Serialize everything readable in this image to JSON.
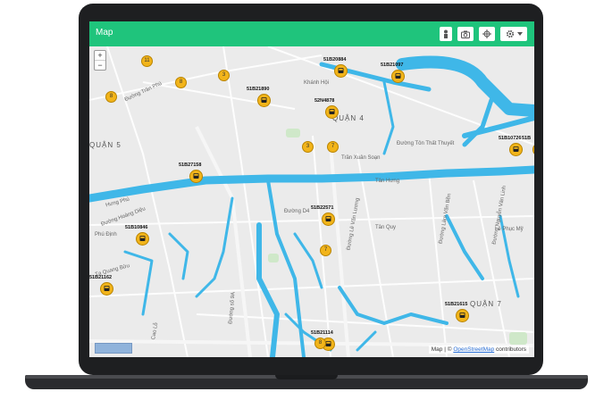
{
  "window": {
    "title": "Map"
  },
  "toolbar": {
    "buttons": [
      {
        "icon": "person-icon"
      },
      {
        "icon": "camera-icon"
      },
      {
        "icon": "crosshair-icon"
      },
      {
        "icon": "gear-icon",
        "has_dropdown": true
      }
    ]
  },
  "zoom": {
    "in_label": "+",
    "out_label": "−"
  },
  "map": {
    "districts": [
      "QUẬN 4",
      "QUẬN 7",
      "QUẬN 5"
    ],
    "streets": [
      "Đường Trần Phú",
      "Đường Tôn Thất Thuyết",
      "Trần Xuân Soạn",
      "Tân Hưng",
      "Đường Lâm Văn Bền",
      "Đường Nguyễn Văn Linh",
      "Lê Phục Mỹ",
      "Đường D4",
      "Đường Lê Văn Lương",
      "Tân Quy",
      "Đường Hoàng Diệu",
      "Tạ Quang Bửu",
      "Cao Lỗ",
      "Đường số 9A",
      "Hưng Phú",
      "Phú Định",
      "Khánh Hội"
    ],
    "vehicles": [
      {
        "label": "51B20884"
      },
      {
        "label": "51B21097"
      },
      {
        "label": "51B21890"
      },
      {
        "label": "52N4878"
      },
      {
        "label": "51B10726"
      },
      {
        "label": "51B27158"
      },
      {
        "label": "51B22571"
      },
      {
        "label": "51B10846"
      },
      {
        "label": "51B21162"
      },
      {
        "label": "51B21615"
      },
      {
        "label": "51B21114"
      },
      {
        "label": "51B"
      }
    ],
    "clusters": [
      "11",
      "8",
      "8",
      "3",
      "3",
      "7",
      "7",
      "8"
    ]
  },
  "attribution": {
    "brand": "Map",
    "separator": "|",
    "copyright": "©",
    "link": "OpenStreetMap",
    "suffix": "contributors"
  },
  "colors": {
    "titlebar": "#1fc47c",
    "water": "#3fb7e8",
    "marker": "#f2b41a",
    "map_bg": "#e9e9e9"
  }
}
